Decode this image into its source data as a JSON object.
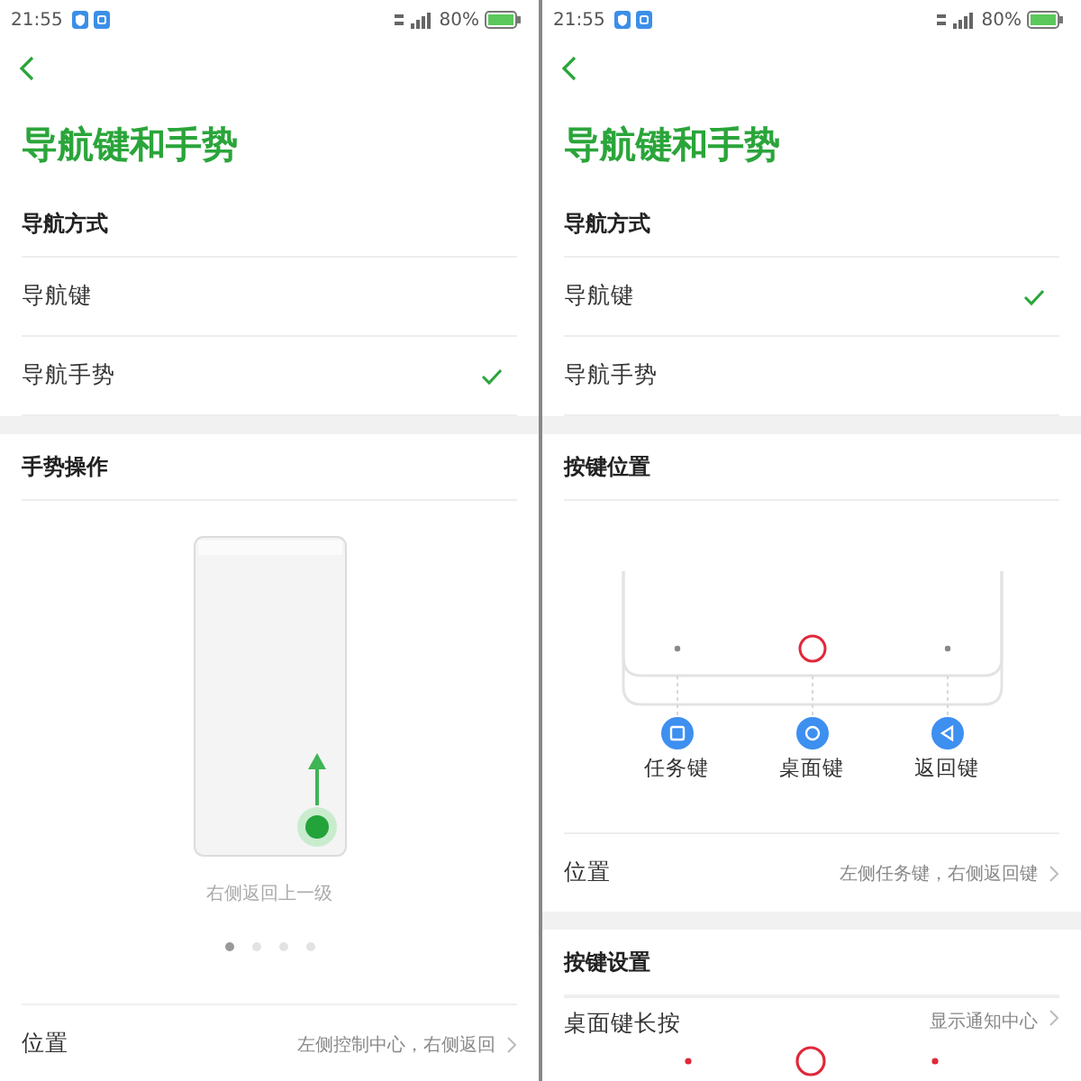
{
  "screens": [
    {
      "status_bar": {
        "time": "21:55",
        "battery": "80%"
      },
      "title": "导航键和手势",
      "nav_bar": false,
      "sections": [
        {
          "kind": "options",
          "heading": "导航方式",
          "options": [
            {
              "label": "导航键",
              "selected": false
            },
            {
              "label": "导航手势",
              "selected": true
            }
          ]
        },
        {
          "kind": "gesture",
          "heading": "手势操作",
          "caption": "右侧返回上一级",
          "pages": [
            {
              "selected": true
            },
            {
              "selected": false
            },
            {
              "selected": false
            },
            {
              "selected": false
            }
          ],
          "rows": [
            {
              "label": "位置",
              "value": "左侧控制中心，右侧返回"
            }
          ]
        }
      ]
    },
    {
      "status_bar": {
        "time": "21:55",
        "battery": "80%"
      },
      "title": "导航键和手势",
      "nav_bar": true,
      "sections": [
        {
          "kind": "options",
          "heading": "导航方式",
          "options": [
            {
              "label": "导航键",
              "selected": true
            },
            {
              "label": "导航手势",
              "selected": false
            }
          ]
        },
        {
          "kind": "keys",
          "heading": "按键位置",
          "keys": [
            {
              "label": "任务键",
              "kind": "square"
            },
            {
              "label": "桌面键",
              "kind": "circle"
            },
            {
              "label": "返回键",
              "kind": "triangle"
            }
          ],
          "rows": [
            {
              "label": "位置",
              "value": "左侧任务键，右侧返回键"
            }
          ]
        },
        {
          "kind": "rows",
          "heading": "按键设置",
          "rows": [
            {
              "label": "桌面键长按",
              "value": "显示通知中心"
            }
          ]
        }
      ]
    }
  ]
}
